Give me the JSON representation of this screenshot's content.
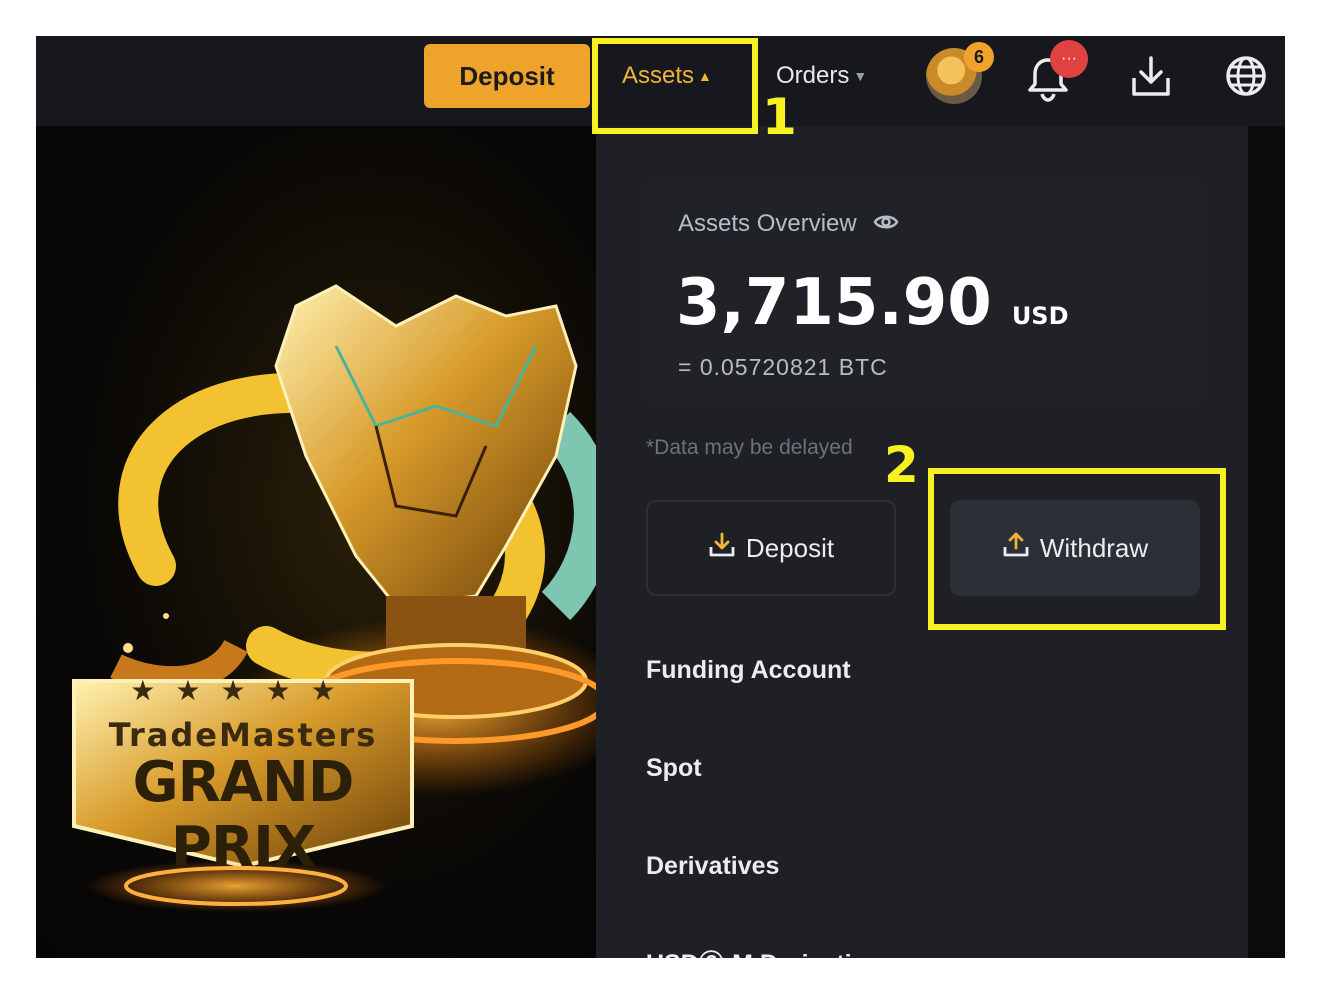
{
  "header": {
    "deposit_label": "Deposit",
    "assets_label": "Assets",
    "orders_label": "Orders",
    "avatar_badge": "6",
    "notification_badge": "···",
    "icons": [
      "avatar",
      "bell-icon",
      "download-icon",
      "globe-icon"
    ]
  },
  "banner": {
    "stars": "★★★★★",
    "title_line1": "TradeMasters",
    "title_line2": "GRAND PRIX"
  },
  "assets_dropdown": {
    "title": "Assets Overview",
    "total_value": "3,715.90",
    "currency": "USD",
    "btc_equivalent": "= 0.05720821 BTC",
    "delay_note": "*Data may be delayed",
    "deposit_button": "Deposit",
    "withdraw_button": "Withdraw",
    "menu_items": [
      "Funding Account",
      "Spot",
      "Derivatives",
      "USDⓈ-M Derivatives"
    ]
  },
  "annotations": {
    "step1": "1",
    "step2": "2",
    "highlight_color": "#f7f120"
  },
  "colors": {
    "accent": "#f0a32b",
    "panel_bg": "#1e2026",
    "topbar_bg": "#16181d"
  }
}
